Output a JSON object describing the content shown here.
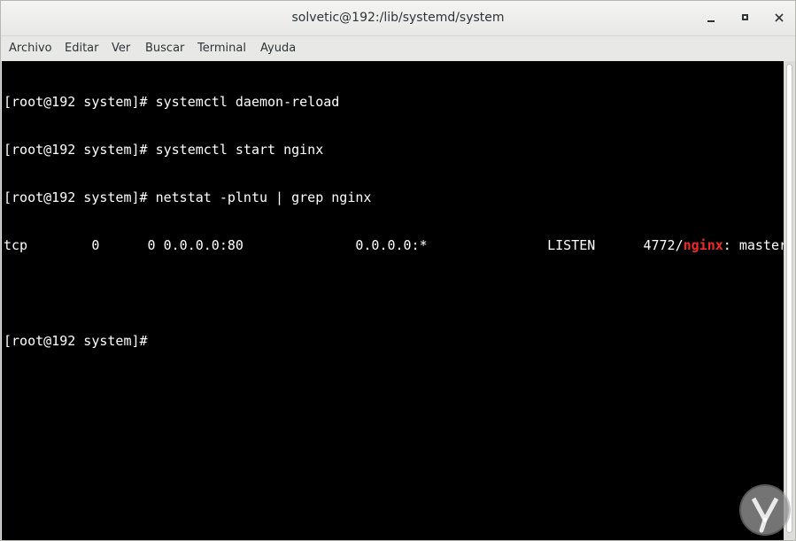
{
  "window": {
    "title": "solvetic@192:/lib/systemd/system"
  },
  "menu": {
    "items": [
      "Archivo",
      "Editar",
      "Ver",
      "Buscar",
      "Terminal",
      "Ayuda"
    ]
  },
  "terminal": {
    "lines": [
      "[root@192 system]# systemctl daemon-reload",
      "[root@192 system]# systemctl start nginx",
      "[root@192 system]# netstat -plntu | grep nginx"
    ],
    "netstat_row": {
      "before": "tcp        0      0 0.0.0.0:80              0.0.0.0:*               LISTEN      4772/",
      "highlight": "nginx",
      "after": ": master"
    },
    "blank_line": "",
    "prompt": "[root@192 system]#"
  },
  "colors": {
    "terminal_bg": "#000000",
    "terminal_fg": "#ffffff",
    "highlight": "#ef2929"
  },
  "icons": {
    "minimize": "minimize-icon",
    "maximize": "maximize-icon",
    "close": "close-icon",
    "watermark": "solvetic-logo"
  }
}
